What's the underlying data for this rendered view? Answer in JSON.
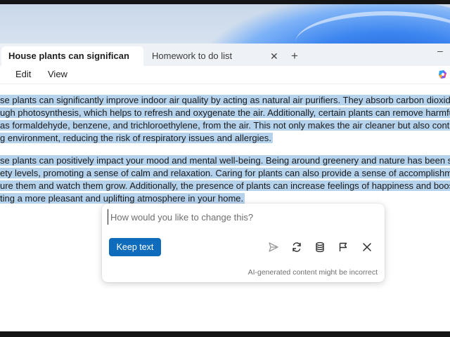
{
  "tabs": [
    {
      "label": "House plants can significan",
      "active": true
    },
    {
      "label": "Homework to do list",
      "active": false
    }
  ],
  "tab_close_glyph": "✕",
  "tab_new_glyph": "+",
  "window_minimize_glyph": "–",
  "menu": [
    "Edit",
    "View"
  ],
  "document": {
    "paragraph1": [
      "se plants can significantly improve indoor air quality by acting as natural air purifiers. They absorb carbon dioxide and release",
      "ugh photosynthesis, which helps to refresh and oxygenate the air. Additionally, certain plants can remove harmful toxins and",
      " as formaldehyde, benzene, and trichloroethylene, from the air. This not only makes the air cleaner but also contributes to a",
      "g environment, reducing the risk of respiratory issues and allergies."
    ],
    "paragraph2": [
      "se plants can positively impact your mood and mental well-being. Being around greenery and nature has been shown to red",
      "ety levels, promoting a sense of calm and relaxation. Caring for plants can also provide a sense of accomplishment and purpo",
      "ure them and watch them grow. Additionally, the presence of plants can increase feelings of happiness and boost your overa",
      "ting a more pleasant and uplifting atmosphere in your home."
    ]
  },
  "rewrite_popup": {
    "placeholder": "How would you like to change this?",
    "value": "",
    "keep_button": "Keep text",
    "disclaimer": "AI-generated content might be incorrect",
    "icons": [
      "send-icon",
      "regenerate-icon",
      "database-icon",
      "flag-icon",
      "close-icon"
    ]
  },
  "colors": {
    "selection": "#b6d3ee",
    "accent": "#0f6cbd"
  }
}
